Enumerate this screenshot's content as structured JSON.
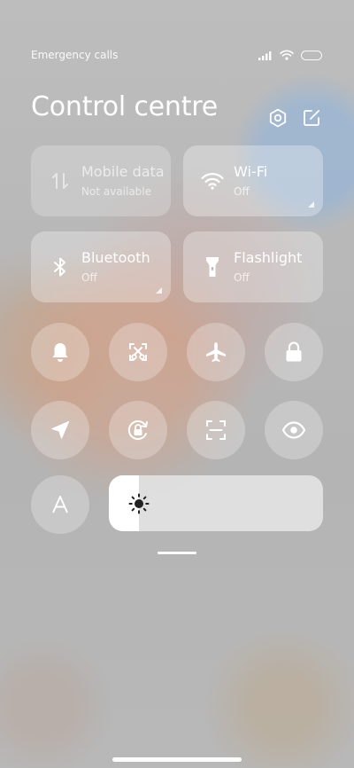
{
  "status_bar": {
    "carrier_text": "Emergency calls o",
    "icons": [
      "signal-icon",
      "wifi-icon",
      "battery-icon"
    ]
  },
  "header": {
    "title": "Control centre",
    "icons": [
      "settings-icon",
      "edit-icon"
    ]
  },
  "tiles": [
    {
      "name": "mobile-data",
      "label": "Mobile data",
      "sub": "Not available",
      "icon": "mobile-data-icon"
    },
    {
      "name": "wifi",
      "label": "Wi-Fi",
      "sub": "Off",
      "icon": "wifi-icon"
    },
    {
      "name": "bluetooth",
      "label": "Bluetooth",
      "sub": "Off",
      "icon": "bluetooth-icon"
    },
    {
      "name": "flashlight",
      "label": "Flashlight",
      "sub": "Off",
      "icon": "flashlight-icon"
    }
  ],
  "toggles": [
    "bell-icon",
    "screenshot-icon",
    "airplane-icon",
    "lock-icon",
    "location-icon",
    "rotation-lock-icon",
    "scan-icon",
    "eye-icon",
    "auto-brightness-icon"
  ],
  "auto_brightness": {
    "glyph": "A"
  },
  "brightness": {
    "level": 0.14,
    "icon": "sun-icon"
  },
  "colors": {
    "tile_bg": "#ffffff4d",
    "text": "#ffffff",
    "slider_bg": "#e8e8e8",
    "slider_fill": "#ffffff"
  }
}
